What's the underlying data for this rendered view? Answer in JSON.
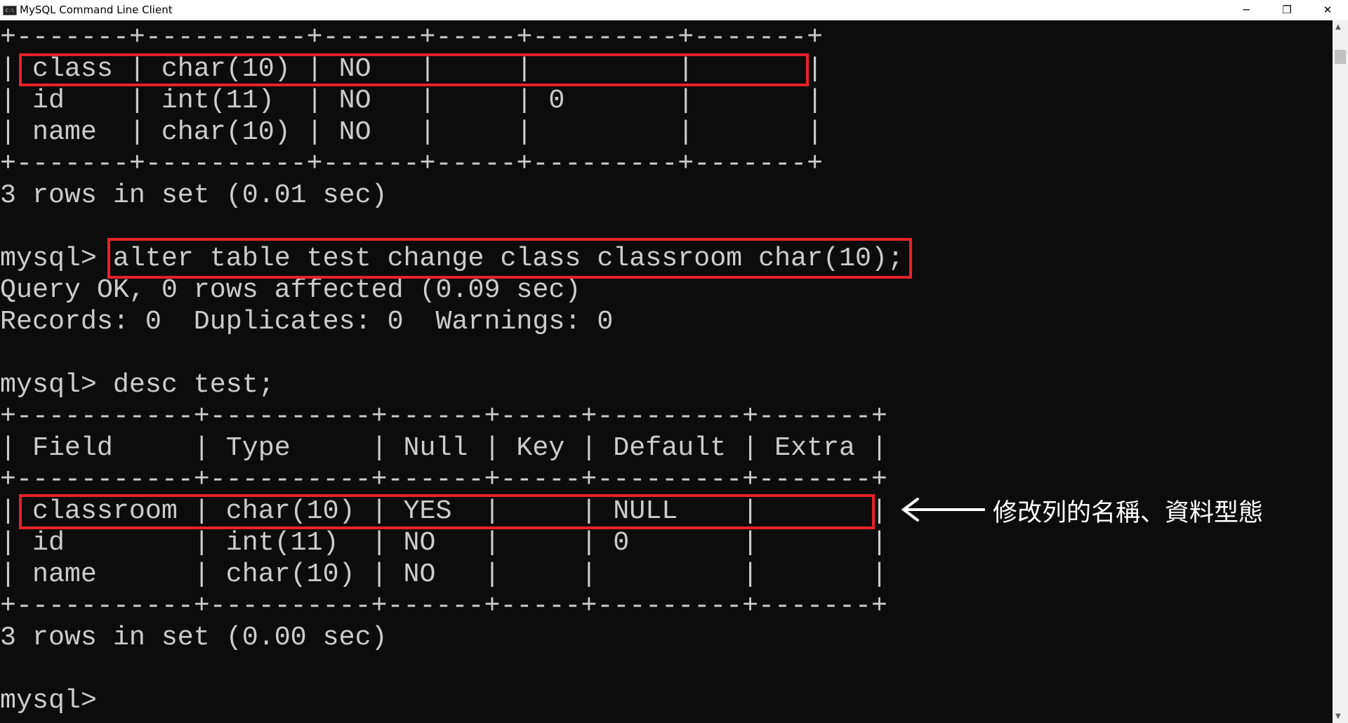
{
  "window": {
    "title": "MySQL Command Line Client",
    "icon": "console-icon",
    "minimize": "─",
    "restore": "❐",
    "close": "✕"
  },
  "console": {
    "lines": [
      "+-------+----------+------+-----+---------+-------+",
      "| class | char(10) | NO   |     |         |       |",
      "| id    | int(11)  | NO   |     | 0       |       |",
      "| name  | char(10) | NO   |     |         |       |",
      "+-------+----------+------+-----+---------+-------+",
      "3 rows in set (0.01 sec)",
      "",
      "mysql> alter table test change class classroom char(10);",
      "Query OK, 0 rows affected (0.09 sec)",
      "Records: 0  Duplicates: 0  Warnings: 0",
      "",
      "mysql> desc test;",
      "+-----------+----------+------+-----+---------+-------+",
      "| Field     | Type     | Null | Key | Default | Extra |",
      "+-----------+----------+------+-----+---------+-------+",
      "| classroom | char(10) | YES  |     | NULL    |       |",
      "| id        | int(11)  | NO   |     | 0       |       |",
      "| name      | char(10) | NO   |     |         |       |",
      "+-----------+----------+------+-----+---------+-------+",
      "3 rows in set (0.00 sec)",
      "",
      "mysql>"
    ]
  },
  "annotation": {
    "text": "修改列的名稱、資料型態",
    "highlight_color": "#e8212b",
    "arrow": "left-arrow"
  }
}
